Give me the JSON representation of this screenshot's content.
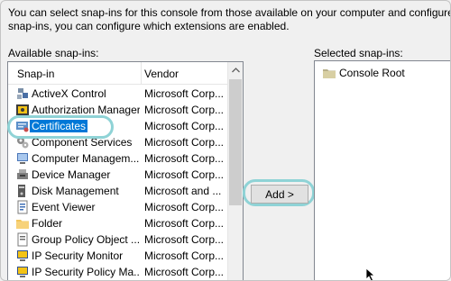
{
  "description": {
    "line1": "You can select snap-ins for this console from those available on your computer and configure the s",
    "line2": "snap-ins, you can configure which extensions are enabled."
  },
  "available": {
    "label": "Available snap-ins:",
    "columns": {
      "snapin": "Snap-in",
      "vendor": "Vendor"
    },
    "items": [
      {
        "name": "ActiveX Control",
        "vendor": "Microsoft Corp...",
        "icon": "activex-icon"
      },
      {
        "name": "Authorization Manager",
        "vendor": "Microsoft Corp...",
        "icon": "authorization-icon"
      },
      {
        "name": "Certificates",
        "vendor": "Microsoft Corp...",
        "icon": "certificates-icon",
        "selected": true
      },
      {
        "name": "Component Services",
        "vendor": "Microsoft Corp...",
        "icon": "component-services-icon"
      },
      {
        "name": "Computer Managem...",
        "vendor": "Microsoft Corp...",
        "icon": "computer-management-icon"
      },
      {
        "name": "Device Manager",
        "vendor": "Microsoft Corp...",
        "icon": "device-manager-icon"
      },
      {
        "name": "Disk Management",
        "vendor": "Microsoft and ...",
        "icon": "disk-management-icon"
      },
      {
        "name": "Event Viewer",
        "vendor": "Microsoft Corp...",
        "icon": "event-viewer-icon"
      },
      {
        "name": "Folder",
        "vendor": "Microsoft Corp...",
        "icon": "folder-icon"
      },
      {
        "name": "Group Policy Object ...",
        "vendor": "Microsoft Corp...",
        "icon": "group-policy-icon"
      },
      {
        "name": "IP Security Monitor",
        "vendor": "Microsoft Corp...",
        "icon": "ip-security-monitor-icon"
      },
      {
        "name": "IP Security Policy Ma...",
        "vendor": "Microsoft Corp...",
        "icon": "ip-security-policy-icon"
      }
    ]
  },
  "add_button": {
    "label": "Add >"
  },
  "selected": {
    "label": "Selected snap-ins:",
    "items": [
      {
        "name": "Console Root",
        "icon": "console-root-folder-icon"
      }
    ]
  },
  "colors": {
    "selection": "#0078d7",
    "highlight_ring": "#8fd3d6"
  }
}
